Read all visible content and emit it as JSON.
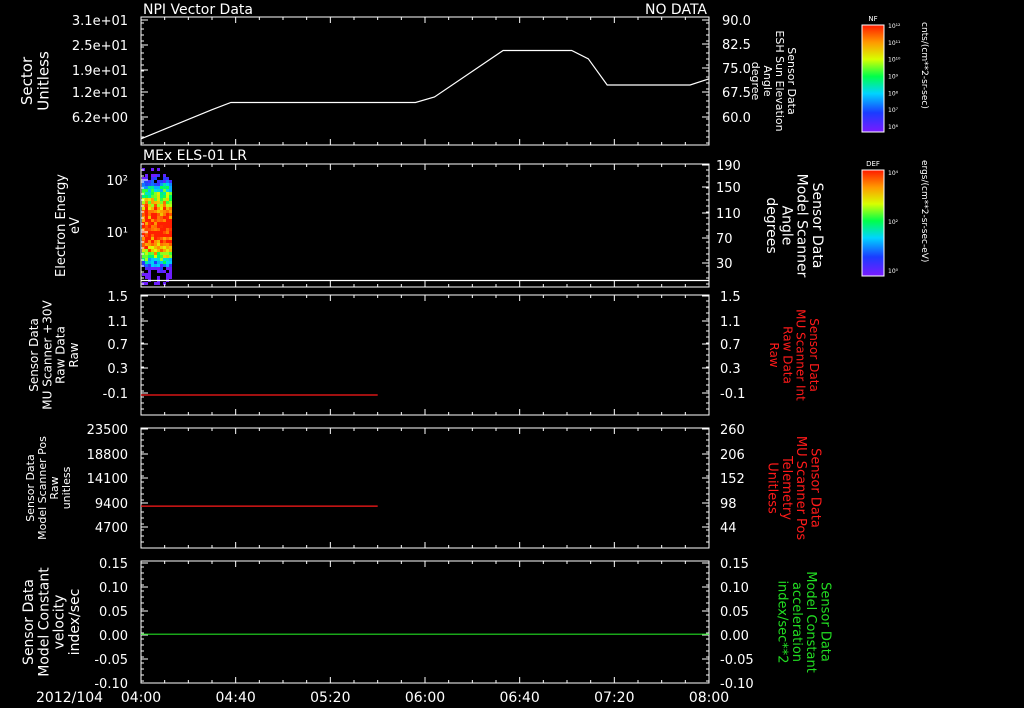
{
  "colors": {
    "axis": "#ffffff",
    "red": "#ff1a1a",
    "green": "#22dd22",
    "bg": "#000000"
  },
  "footer": {
    "date": "2012/104"
  },
  "x_ticks": [
    "04:00",
    "04:40",
    "05:20",
    "06:00",
    "06:40",
    "07:20",
    "08:00"
  ],
  "colorbars": [
    {
      "title": "NF",
      "unit": "cnts/(cm**2-sr-sec)",
      "tick_labels": [
        "10¹²",
        "10¹¹",
        "10¹⁰",
        "10⁹",
        "10⁸",
        "10⁷",
        "10⁶"
      ]
    },
    {
      "title": "DEF",
      "unit": "ergs/(cm**2-sr-sec-eV)",
      "tick_labels": [
        "10⁴",
        "10²",
        "10⁰"
      ]
    }
  ],
  "chart_data": [
    {
      "type": "line",
      "title": "NPI Vector Data",
      "status": "NO DATA",
      "ylabel": [
        "Sector",
        "Unitless"
      ],
      "left_ticks": [
        "3.1e+01",
        "2.5e+01",
        "1.9e+01",
        "1.2e+01",
        "6.2e+00"
      ],
      "right_ticks": [
        "90.0",
        "82.5",
        "75.0",
        "67.5",
        "60.0"
      ],
      "right_label": [
        "Sensor Data",
        "ESH Sun Elevation",
        "Angle",
        "degree"
      ],
      "right_label_color": "white",
      "right_ylim": [
        54.8,
        90.0
      ],
      "series": [
        {
          "color": "white",
          "x": [
            "04:00",
            "04:30",
            "04:38",
            "05:56",
            "06:04",
            "06:33",
            "07:02",
            "07:09",
            "07:17",
            "07:52",
            "08:00"
          ],
          "y": [
            56.5,
            64.5,
            66.5,
            66.5,
            68.0,
            80.8,
            80.8,
            78.5,
            71.3,
            71.3,
            73.0
          ]
        }
      ]
    },
    {
      "type": "heatmap",
      "title": "MEx ELS-01 LR",
      "ylabel": [
        "Electron Energy",
        "eV"
      ],
      "left_ticks": [
        "10²",
        "10¹"
      ],
      "left_log_range": [
        0.3,
        2.35
      ],
      "left_tick_values": [
        100,
        10
      ],
      "right_ticks": [
        "190",
        "150",
        "110",
        "70",
        "30"
      ],
      "right_label": [
        "Sensor Data",
        "Model Scanner",
        "Angle",
        "degrees"
      ],
      "right_label_color": "white",
      "right_ylim": [
        2,
        190
      ],
      "heatmap": {
        "x_range": [
          "04:00",
          "04:13"
        ],
        "peak_energy_eV": 20,
        "peak_label": "DEF"
      },
      "series": [
        {
          "color": "white",
          "x": [
            "04:00",
            "08:00"
          ],
          "y": [
            12,
            12
          ]
        }
      ]
    },
    {
      "type": "line",
      "ylabel": [
        "Sensor Data",
        "MU Scanner +30V",
        "Raw Data",
        "Raw"
      ],
      "left_ticks": [
        "1.5",
        "1.1",
        "0.7",
        "0.3",
        "-0.1"
      ],
      "right_ticks": [
        "1.5",
        "1.1",
        "0.7",
        "0.3",
        "-0.1"
      ],
      "right_label": [
        "Sensor Data",
        "MU Scanner Int",
        "Raw Data",
        "Raw"
      ],
      "right_label_color": "red",
      "right_ylim": [
        -0.3,
        1.5
      ],
      "series": [
        {
          "color": "red",
          "x": [
            "04:00",
            "05:40"
          ],
          "y": [
            0.0,
            0.0
          ]
        }
      ]
    },
    {
      "type": "line",
      "ylabel": [
        "Sensor Data",
        "Model Scanner Pos",
        "Raw",
        "unitless"
      ],
      "left_ticks": [
        "23500",
        "18800",
        "14100",
        "9400",
        "4700"
      ],
      "right_ticks": [
        "260",
        "206",
        "152",
        "98",
        "44"
      ],
      "right_label": [
        "Sensor Data",
        "MU Scanner Pos",
        "Telemetry",
        "Unitless"
      ],
      "right_label_color": "red",
      "left_ylim": [
        0,
        23500
      ],
      "series": [
        {
          "color": "red",
          "x": [
            "04:00",
            "05:40"
          ],
          "y": [
            8200,
            8200
          ]
        }
      ]
    },
    {
      "type": "line",
      "ylabel": [
        "Sensor Data",
        "Model Constant",
        "velocity",
        "index/sec"
      ],
      "left_ticks": [
        "0.15",
        "0.10",
        "0.05",
        "0.00",
        "-0.05",
        "-0.10"
      ],
      "right_ticks": [
        "0.15",
        "0.10",
        "0.05",
        "0.00",
        "-0.05",
        "-0.10"
      ],
      "right_label": [
        "Sensor Data",
        "Model Constant",
        "acceleration",
        "index/sec**2"
      ],
      "right_label_color": "green",
      "left_ylim": [
        -0.1,
        0.15
      ],
      "series": [
        {
          "color": "green",
          "x": [
            "04:00",
            "08:00"
          ],
          "y": [
            0.0,
            0.0
          ]
        }
      ]
    }
  ]
}
